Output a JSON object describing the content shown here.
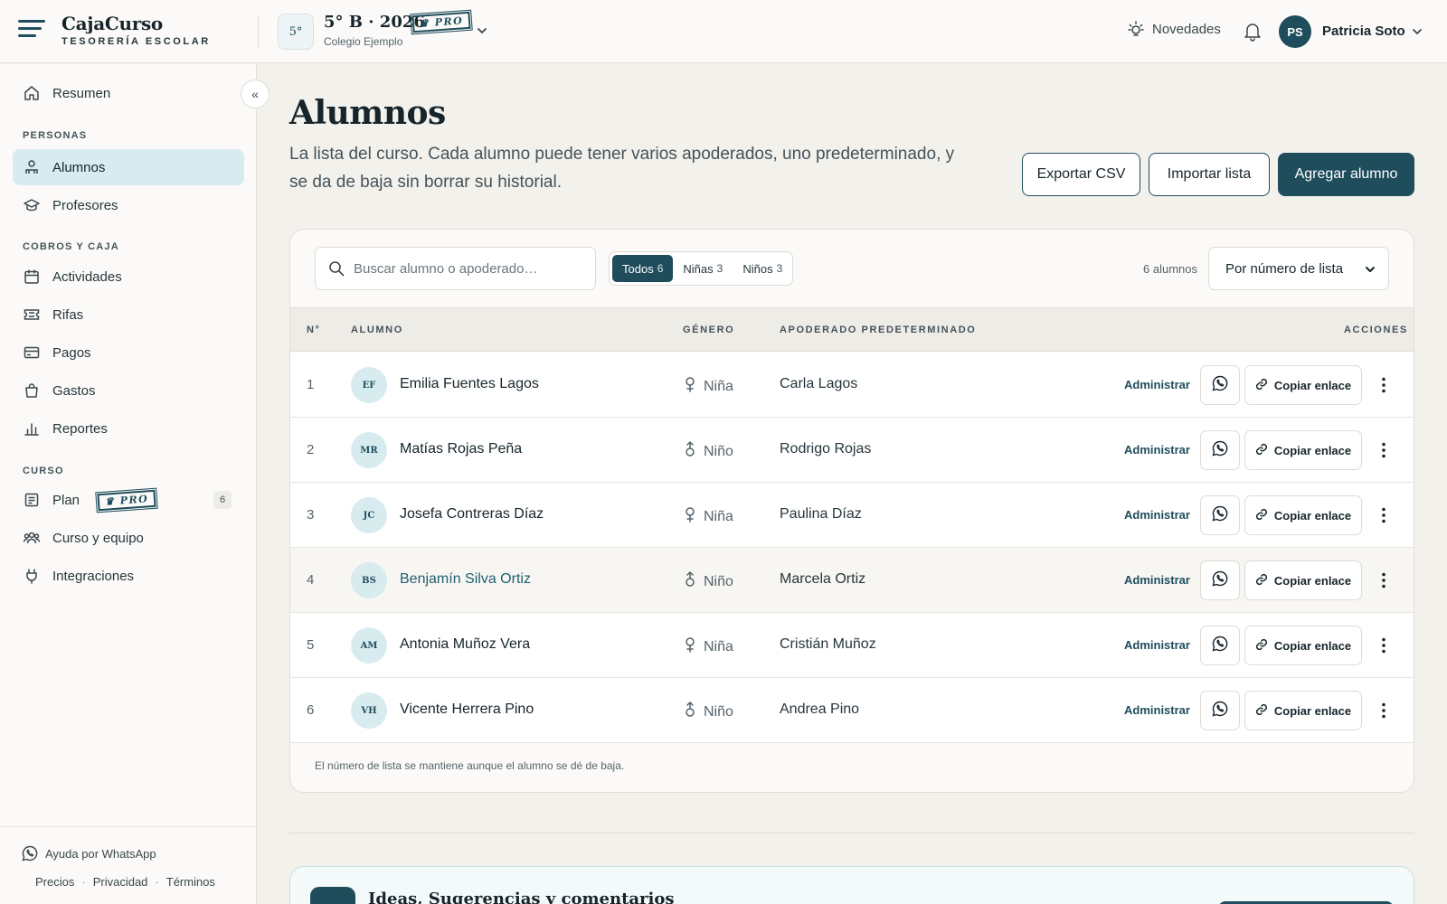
{
  "brand": {
    "name": "CajaCurso",
    "subtitle": "TESORERÍA ESCOLAR"
  },
  "course": {
    "badge": "5°",
    "title": "5° B · 2026",
    "pro": "PRO",
    "school": "Colegio Ejemplo"
  },
  "header": {
    "news_label": "Novedades",
    "user_initials": "PS",
    "user_name": "Patricia Soto"
  },
  "sidebar": {
    "summary": "Resumen",
    "section_people": "PERSONAS",
    "students": "Alumnos",
    "teachers": "Profesores",
    "section_billing": "COBROS Y CAJA",
    "activities": "Actividades",
    "raffles": "Rifas",
    "payments": "Pagos",
    "expenses": "Gastos",
    "reports": "Reportes",
    "section_course": "CURSO",
    "plan": "Plan",
    "plan_pro": "PRO",
    "plan_count": "6",
    "team": "Curso y equipo",
    "integrations": "Integraciones",
    "help": "Ayuda por WhatsApp",
    "footer_prices": "Precios",
    "footer_privacy": "Privacidad",
    "footer_terms": "Términos",
    "footer_sep": "·"
  },
  "page": {
    "title": "Alumnos",
    "description": "La lista del curso. Cada alumno puede tener varios apoderados, uno predeterminado, y se da de baja sin borrar su historial.",
    "export_label": "Exportar CSV",
    "import_label": "Importar lista",
    "add_label": "Agregar alumno"
  },
  "toolbar": {
    "search_placeholder": "Buscar alumno o apoderado…",
    "filters": [
      {
        "label": "Todos",
        "count": "6"
      },
      {
        "label": "Niñas",
        "count": "3"
      },
      {
        "label": "Niños",
        "count": "3"
      }
    ],
    "count_label": "6 alumnos",
    "sort_value": "Por número de lista"
  },
  "table": {
    "headers": {
      "num": "N°",
      "student": "ALUMNO",
      "gender": "GÉNERO",
      "guardian": "APODERADO PREDETERMINADO",
      "actions": "ACCIONES"
    },
    "admin_label": "Administrar",
    "copy_label": "Copiar enlace",
    "rows": [
      {
        "num": "1",
        "initials": "EF",
        "name": "Emilia Fuentes Lagos",
        "gender": "Niña",
        "guardian": "Carla Lagos"
      },
      {
        "num": "2",
        "initials": "MR",
        "name": "Matías Rojas Peña",
        "gender": "Niño",
        "guardian": "Rodrigo Rojas"
      },
      {
        "num": "3",
        "initials": "JC",
        "name": "Josefa Contreras Díaz",
        "gender": "Niña",
        "guardian": "Paulina Díaz"
      },
      {
        "num": "4",
        "initials": "BS",
        "name": "Benjamín Silva Ortiz",
        "gender": "Niño",
        "guardian": "Marcela Ortiz"
      },
      {
        "num": "5",
        "initials": "AM",
        "name": "Antonia Muñoz Vera",
        "gender": "Niña",
        "guardian": "Cristián Muñoz"
      },
      {
        "num": "6",
        "initials": "VH",
        "name": "Vicente Herrera Pino",
        "gender": "Niño",
        "guardian": "Andrea Pino"
      }
    ],
    "note": "El número de lista se mantiene aunque el alumno se dé de baja."
  },
  "ideas": {
    "title": "Ideas, Sugerencias y comentarios"
  },
  "colors": {
    "accent": "#1f4d5c",
    "active_nav": "#d8ecf0",
    "background": "#f3f1ec"
  }
}
